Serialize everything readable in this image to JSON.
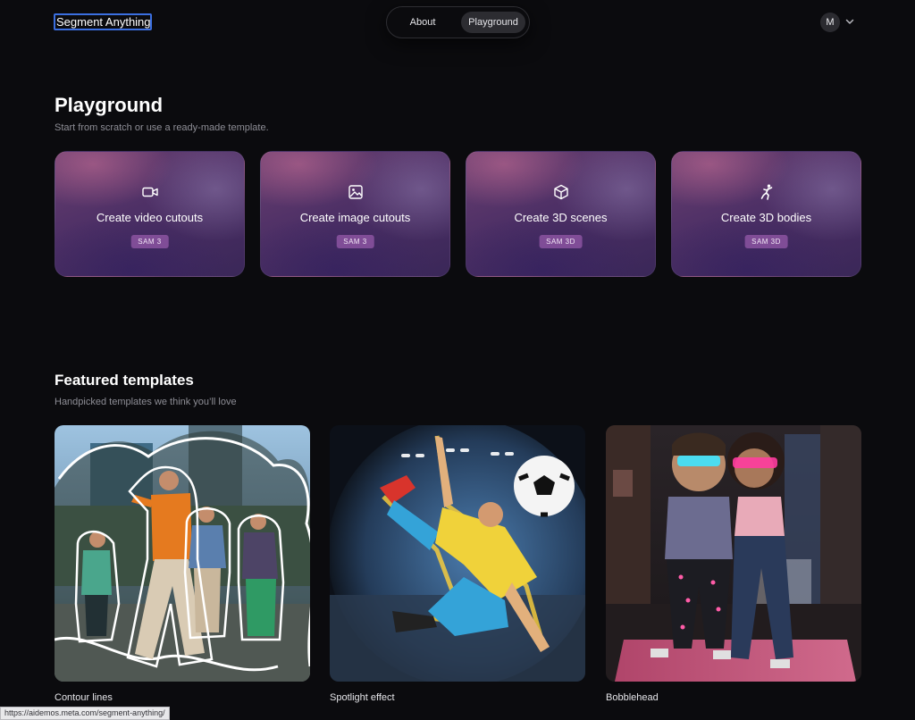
{
  "header": {
    "brand": "Segment Anything",
    "nav": [
      {
        "label": "About",
        "active": false
      },
      {
        "label": "Playground",
        "active": true
      }
    ],
    "avatar_initial": "M",
    "avatar_menu_icon": "chevron-down-icon"
  },
  "playground": {
    "title": "Playground",
    "subtitle": "Start from scratch or use a ready-made template.",
    "cards": [
      {
        "icon": "video-camera-icon",
        "title": "Create video cutouts",
        "badge": "SAM 3"
      },
      {
        "icon": "image-icon",
        "title": "Create image cutouts",
        "badge": "SAM 3"
      },
      {
        "icon": "cube-icon",
        "title": "Create 3D scenes",
        "badge": "SAM 3D"
      },
      {
        "icon": "person-dancing-icon",
        "title": "Create 3D bodies",
        "badge": "SAM 3D"
      }
    ]
  },
  "featured": {
    "title": "Featured templates",
    "subtitle": "Handpicked templates we think you’ll love",
    "templates": [
      {
        "label": "Contour lines"
      },
      {
        "label": "Spotlight effect"
      },
      {
        "label": "Bobblehead"
      }
    ]
  },
  "status_bar": {
    "url": "https://aidemos.meta.com/segment-anything/"
  },
  "colors": {
    "background": "#0b0b0e",
    "focus_ring": "#3b6fe0",
    "badge": "#965aaa",
    "card_gradient_start": "#6a3f70",
    "card_gradient_end": "#3a2758"
  }
}
